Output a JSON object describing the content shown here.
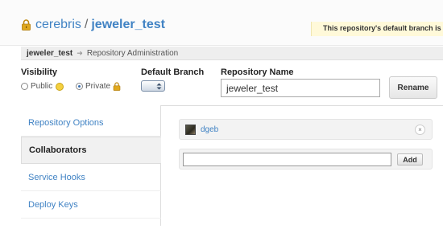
{
  "header": {
    "owner": "cerebris",
    "separator": "/",
    "repo_name": "jeweler_test",
    "branch_notice": "This repository's default branch is em"
  },
  "breadcrumb": {
    "repo": "jeweler_test",
    "arrow": "➜",
    "page": "Repository Administration"
  },
  "settings": {
    "visibility_label": "Visibility",
    "public_label": "Public",
    "private_label": "Private",
    "selected_visibility": "Private",
    "default_branch_label": "Default Branch",
    "repo_name_label": "Repository Name",
    "repo_name_value": "jeweler_test",
    "rename_label": "Rename"
  },
  "sidebar": {
    "items": [
      {
        "label": "Repository Options",
        "active": false
      },
      {
        "label": "Collaborators",
        "active": true
      },
      {
        "label": "Service Hooks",
        "active": false
      },
      {
        "label": "Deploy Keys",
        "active": false
      }
    ]
  },
  "collaborators": {
    "list": [
      {
        "name": "dgeb"
      }
    ],
    "remove_glyph": "×",
    "add_input_value": "",
    "add_label": "Add"
  },
  "colors": {
    "link": "#4183c4",
    "notice_bg": "#fff9d9",
    "lock_gold": "#e0a81d"
  }
}
